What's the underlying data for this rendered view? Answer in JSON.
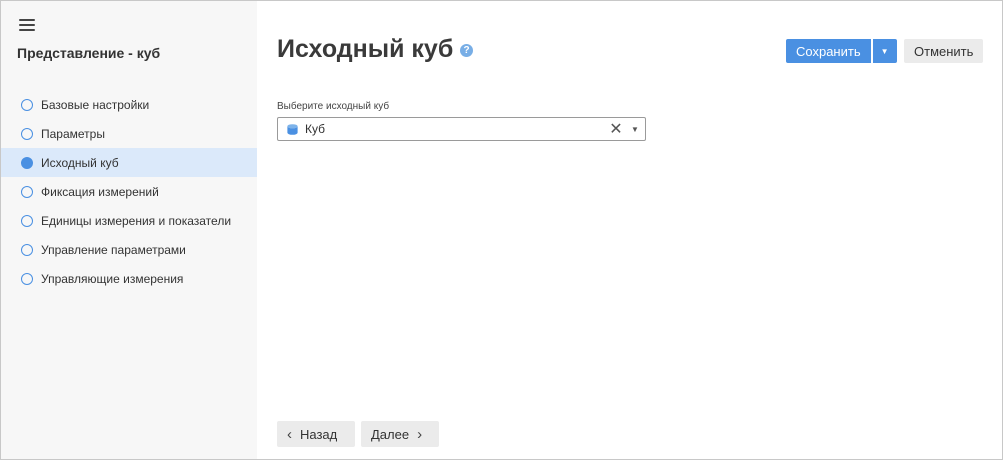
{
  "sidebar": {
    "title": "Представление - куб",
    "steps": [
      {
        "label": "Базовые настройки",
        "active": false
      },
      {
        "label": "Параметры",
        "active": false
      },
      {
        "label": "Исходный куб",
        "active": true
      },
      {
        "label": "Фиксация измерений",
        "active": false
      },
      {
        "label": "Единицы измерения и показатели",
        "active": false
      },
      {
        "label": "Управление параметрами",
        "active": false
      },
      {
        "label": "Управляющие измерения",
        "active": false
      }
    ]
  },
  "main": {
    "title": "Исходный куб",
    "save_label": "Сохранить",
    "cancel_label": "Отменить",
    "field_label": "Выберите исходный куб",
    "selected_value": "Куб",
    "back_label": "Назад",
    "next_label": "Далее"
  },
  "colors": {
    "accent": "#4a90e2",
    "active_step_bg": "#dbe9fa",
    "sidebar_bg": "#f7f7f7"
  },
  "icons": {
    "menu": "hamburger-icon",
    "help": "question-circle-icon",
    "cube": "cube-icon",
    "clear": "close-icon",
    "dropdown": "caret-down-icon",
    "back": "chevron-left-icon",
    "next": "chevron-right-icon"
  }
}
